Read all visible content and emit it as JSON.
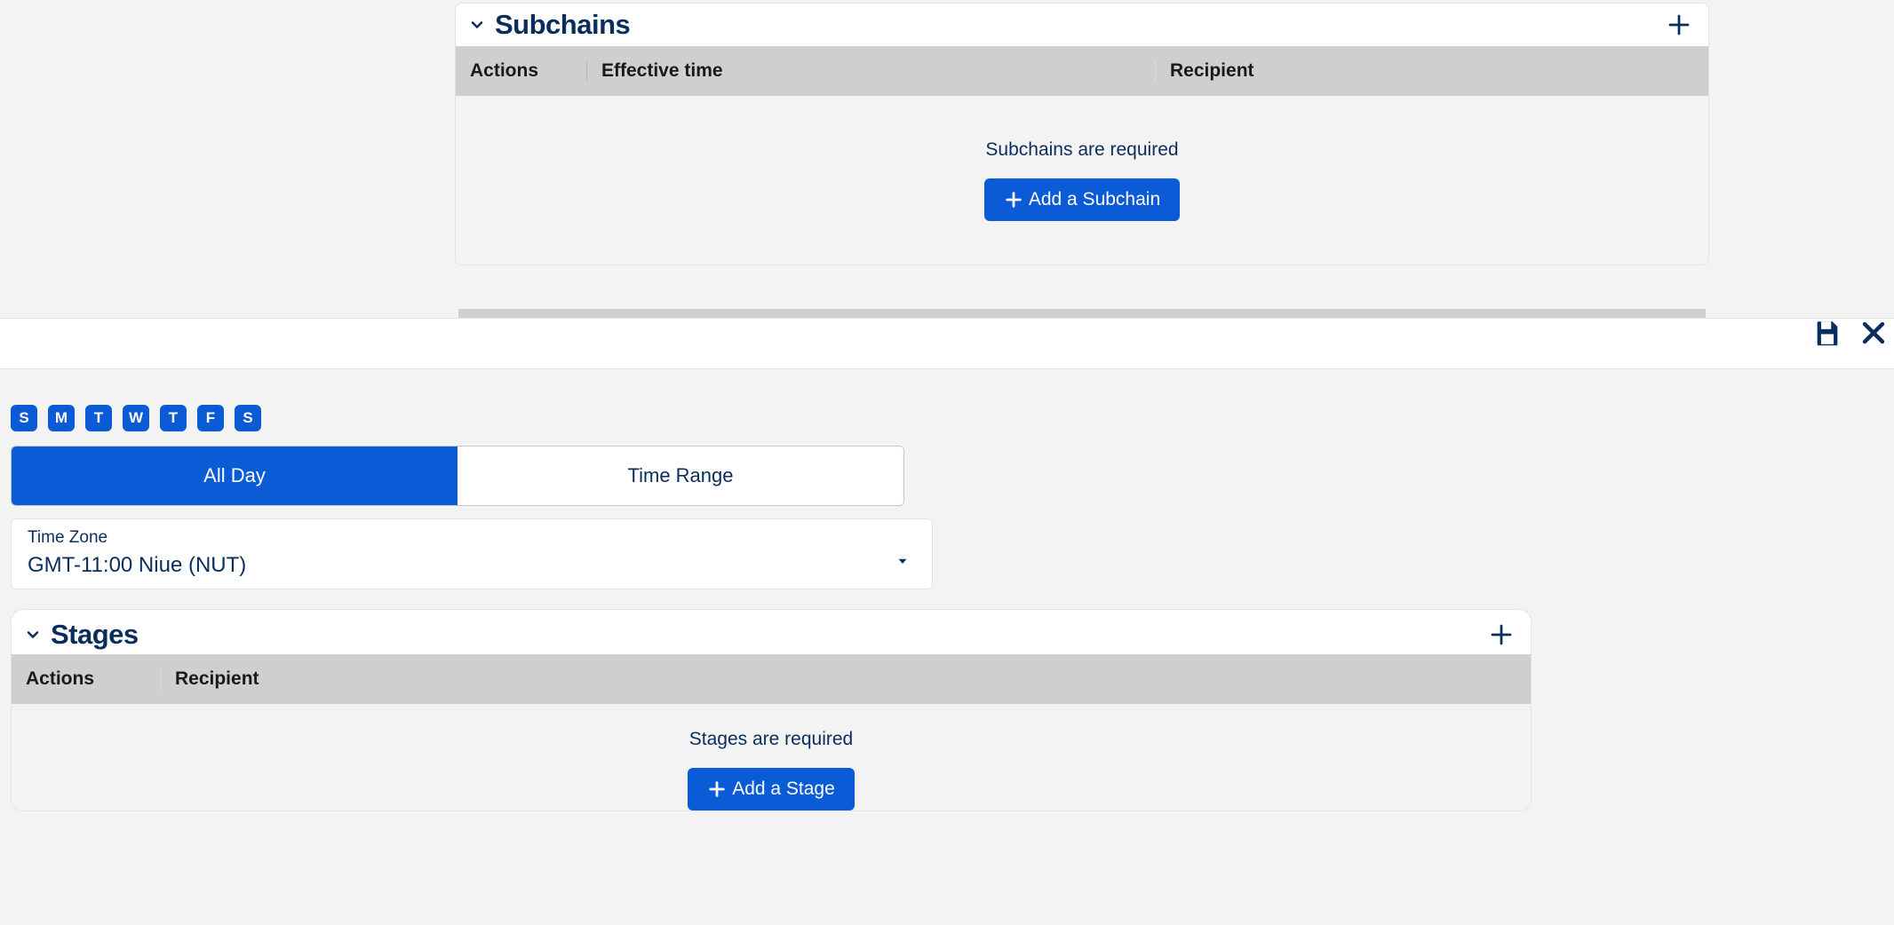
{
  "subchains": {
    "title": "Subchains",
    "columns": {
      "actions": "Actions",
      "effective": "Effective time",
      "recipient": "Recipient"
    },
    "empty_text": "Subchains are required",
    "add_button": "Add a Subchain"
  },
  "toolbar": {
    "save_icon": "save-icon",
    "close_icon": "close-icon"
  },
  "days": [
    "S",
    "M",
    "T",
    "W",
    "T",
    "F",
    "S"
  ],
  "time_toggle": {
    "all_day": "All Day",
    "range": "Time Range"
  },
  "timezone": {
    "label": "Time Zone",
    "value": "GMT-11:00 Niue (NUT)"
  },
  "stages": {
    "title": "Stages",
    "columns": {
      "actions": "Actions",
      "recipient": "Recipient"
    },
    "empty_text": "Stages are required",
    "add_button": "Add a Stage"
  }
}
